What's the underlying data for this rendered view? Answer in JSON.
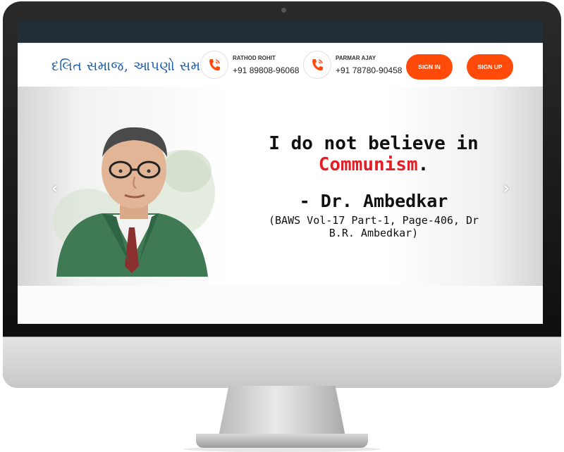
{
  "site": {
    "logo_text": "દલિત સમાજ, આપણો સમાજ"
  },
  "contacts": [
    {
      "name": "RATHOD ROHIT",
      "phone": "+91 89808-96068"
    },
    {
      "name": "PARMAR AJAY",
      "phone": "+91 78780-90458"
    }
  ],
  "buttons": {
    "sign_in": "SIGN IN",
    "sign_up": "SIGN UP"
  },
  "slide": {
    "line1": "I do not believe in",
    "line2_word": "Communism",
    "line2_end": ".",
    "author": "- Dr. Ambedkar",
    "source_line1": "(BAWS Vol-17  Part-1, Page-406, Dr",
    "source_line2": "B.R. Ambedkar)"
  },
  "colors": {
    "accent": "#ff4a0a",
    "logo": "#1f5fa8",
    "highlight": "#e31e24",
    "topbar": "#232d35"
  },
  "icons": {
    "phone": "phone-icon",
    "prev": "chevron-left-icon",
    "next": "chevron-right-icon"
  }
}
